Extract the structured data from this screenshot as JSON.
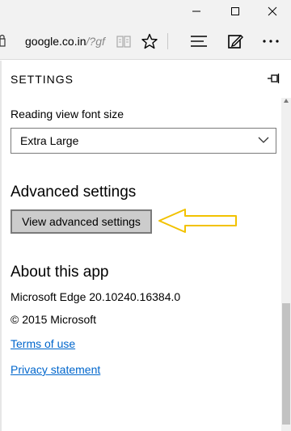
{
  "window": {
    "minimize_icon": "minimize-icon",
    "maximize_icon": "maximize-icon",
    "close_icon": "close-icon"
  },
  "toolbar": {
    "address_text": "google.co.in",
    "address_path": "/?gf",
    "icons": [
      "reading-view-icon",
      "favorite-star-icon",
      "hub-icon",
      "web-note-icon",
      "more-icon"
    ]
  },
  "settings": {
    "title": "SETTINGS",
    "reading_font_label": "Reading view font size",
    "reading_font_value": "Extra Large",
    "advanced_heading": "Advanced settings",
    "advanced_button": "View advanced settings",
    "about_heading": "About this app",
    "version": "Microsoft Edge 20.10240.16384.0",
    "copyright": "© 2015 Microsoft",
    "terms_link": "Terms of use",
    "privacy_link": "Privacy statement"
  },
  "colors": {
    "accent_link": "#0066cc",
    "annotation_arrow": "#f2c200",
    "button_bg": "#cccccc"
  }
}
